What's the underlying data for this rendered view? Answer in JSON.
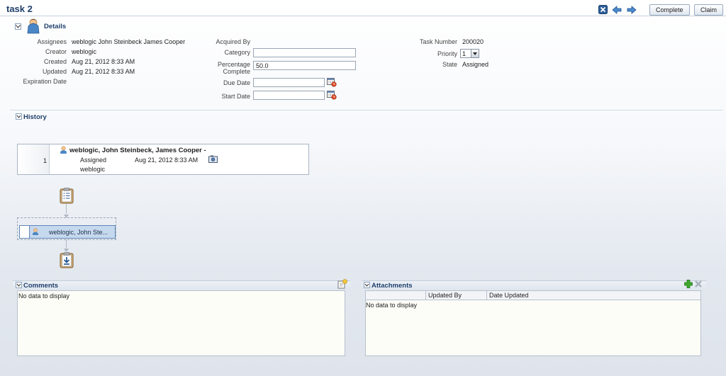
{
  "header": {
    "title": "task 2",
    "complete_label": "Complete",
    "claim_label": "Claim"
  },
  "details": {
    "section_title": "Details",
    "left": [
      {
        "label": "Assignees",
        "value": "weblogic John Steinbeck James Cooper"
      },
      {
        "label": "Creator",
        "value": "weblogic"
      },
      {
        "label": "Created",
        "value": "Aug 21, 2012 8:33 AM"
      },
      {
        "label": "Updated",
        "value": "Aug 21, 2012 8:33 AM"
      },
      {
        "label": "Expiration Date",
        "value": ""
      }
    ],
    "acquired_by_label": "Acquired By",
    "category_label": "Category",
    "category_value": "",
    "percentage_label_1": "Percentage",
    "percentage_label_2": "Complete",
    "percentage_value": "50.0",
    "due_date_label": "Due Date",
    "due_date_value": "",
    "start_date_label": "Start Date",
    "start_date_value": "",
    "task_number_label": "Task Number",
    "task_number_value": "200020",
    "priority_label": "Priority",
    "priority_value": "1",
    "state_label": "State",
    "state_value": "Assigned"
  },
  "history": {
    "section_title": "History",
    "row_number": "1",
    "participants": "weblogic, John Steinbeck, James Cooper -",
    "action": "Assigned",
    "date": "Aug 21, 2012 8:33 AM",
    "actor": "weblogic",
    "node_label": "weblogic, John Ste..."
  },
  "comments": {
    "title": "Comments",
    "empty_text": "No data to display"
  },
  "attachments": {
    "title": "Attachments",
    "columns": [
      "",
      "Updated By",
      "Date Updated"
    ],
    "empty_text": "No data to display"
  }
}
